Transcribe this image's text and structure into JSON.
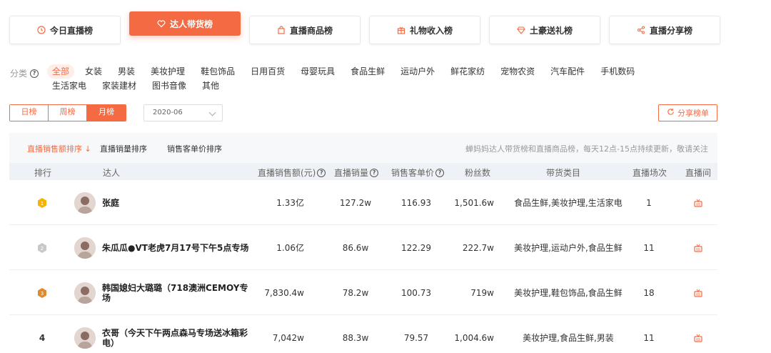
{
  "top_tabs": [
    {
      "label": "今日直播榜",
      "icon": "clock-icon",
      "active": false
    },
    {
      "label": "达人带货榜",
      "icon": "heart-icon",
      "active": true
    },
    {
      "label": "直播商品榜",
      "icon": "shopping-bag-icon",
      "active": false
    },
    {
      "label": "礼物收入榜",
      "icon": "gift-icon",
      "active": false
    },
    {
      "label": "土豪送礼榜",
      "icon": "diamond-icon",
      "active": false
    },
    {
      "label": "直播分享榜",
      "icon": "share-icon",
      "active": false
    }
  ],
  "category": {
    "label": "分类",
    "items": [
      "全部",
      "女装",
      "男装",
      "美妆护理",
      "鞋包饰品",
      "日用百货",
      "母婴玩具",
      "食品生鲜",
      "运动户外",
      "鲜花家纺",
      "宠物农资",
      "汽车配件",
      "手机数码",
      "生活家电",
      "家装建材",
      "图书音像",
      "其他"
    ],
    "active_index": 0
  },
  "period": {
    "buttons": [
      "日榜",
      "周榜",
      "月榜"
    ],
    "active_index": 2
  },
  "date_select": {
    "value": "2020-06"
  },
  "share_button": {
    "label": "分享榜单"
  },
  "sort": {
    "items": [
      "直播销售额排序 ↓",
      "直播销量排序",
      "销售客单价排序"
    ],
    "active_index": 0,
    "note": "蝉妈妈达人带货榜和直播商品榜，每天12点-15点持续更新，敬请关注"
  },
  "table": {
    "headers": {
      "rank": "排行",
      "anchor": "达人",
      "sales_amount": "直播销售额(元)",
      "sales_volume": "直播销量",
      "unit_price": "销售客单价",
      "fans": "粉丝数",
      "category": "带货类目",
      "sessions": "直播场次",
      "live_room": "直播间"
    },
    "rows": [
      {
        "rank": "1",
        "medal": "gold",
        "name": "张庭",
        "sales_amount": "1.33亿",
        "sales_volume": "127.2w",
        "unit_price": "116.93",
        "fans": "1,501.6w",
        "category": "食品生鲜,美妆护理,生活家电",
        "sessions": "1"
      },
      {
        "rank": "2",
        "medal": "silver",
        "name": "朱瓜瓜●VT老虎7月17号下午5点专场",
        "sales_amount": "1.06亿",
        "sales_volume": "86.6w",
        "unit_price": "122.29",
        "fans": "222.7w",
        "category": "美妆护理,运动户外,食品生鲜",
        "sessions": "11"
      },
      {
        "rank": "3",
        "medal": "bronze",
        "name": "韩国媳妇大璐璐（718澳洲CEMOY专场",
        "sales_amount": "7,830.4w",
        "sales_volume": "78.2w",
        "unit_price": "100.73",
        "fans": "719w",
        "category": "美妆护理,鞋包饰品,食品生鲜",
        "sessions": "18"
      },
      {
        "rank": "4",
        "medal": "",
        "name": "衣哥（今天下午两点森马专场送冰箱彩电）",
        "sales_amount": "7,042w",
        "sales_volume": "88.3w",
        "unit_price": "79.57",
        "fans": "1,004.6w",
        "category": "美妆护理,食品生鲜,男装",
        "sessions": "11"
      }
    ]
  },
  "colors": {
    "accent": "#f46a43",
    "gold": "#f5b400",
    "silver": "#c8c8c8",
    "bronze": "#e08a2e"
  }
}
